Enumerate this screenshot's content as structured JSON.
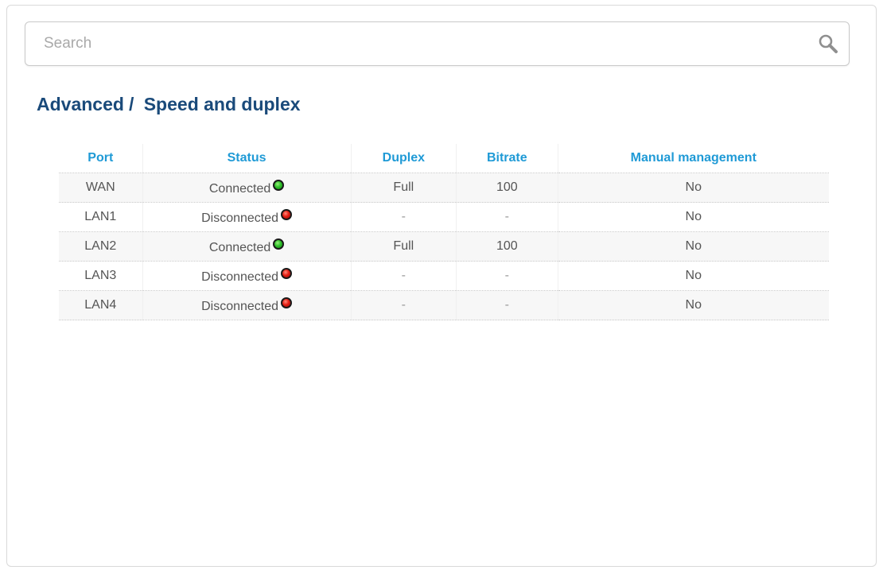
{
  "search": {
    "placeholder": "Search",
    "value": ""
  },
  "breadcrumb": {
    "parent": "Advanced",
    "separator": "/",
    "current": "Speed and duplex"
  },
  "table": {
    "headers": {
      "port": "Port",
      "status": "Status",
      "duplex": "Duplex",
      "bitrate": "Bitrate",
      "manual": "Manual management"
    },
    "rows": [
      {
        "port": "WAN",
        "status": "Connected",
        "status_state": "connected",
        "duplex": "Full",
        "bitrate": "100",
        "manual": "No"
      },
      {
        "port": "LAN1",
        "status": "Disconnected",
        "status_state": "disconnected",
        "duplex": "-",
        "bitrate": "-",
        "manual": "No"
      },
      {
        "port": "LAN2",
        "status": "Connected",
        "status_state": "connected",
        "duplex": "Full",
        "bitrate": "100",
        "manual": "No"
      },
      {
        "port": "LAN3",
        "status": "Disconnected",
        "status_state": "disconnected",
        "duplex": "-",
        "bitrate": "-",
        "manual": "No"
      },
      {
        "port": "LAN4",
        "status": "Disconnected",
        "status_state": "disconnected",
        "duplex": "-",
        "bitrate": "-",
        "manual": "No"
      }
    ]
  },
  "colors": {
    "title": "#1a4a7a",
    "header": "#1f9ad6",
    "connected": "#2fc12a",
    "disconnected": "#e51f14"
  },
  "icons": {
    "search": "search-icon",
    "connected": "status-connected-icon",
    "disconnected": "status-disconnected-icon"
  }
}
